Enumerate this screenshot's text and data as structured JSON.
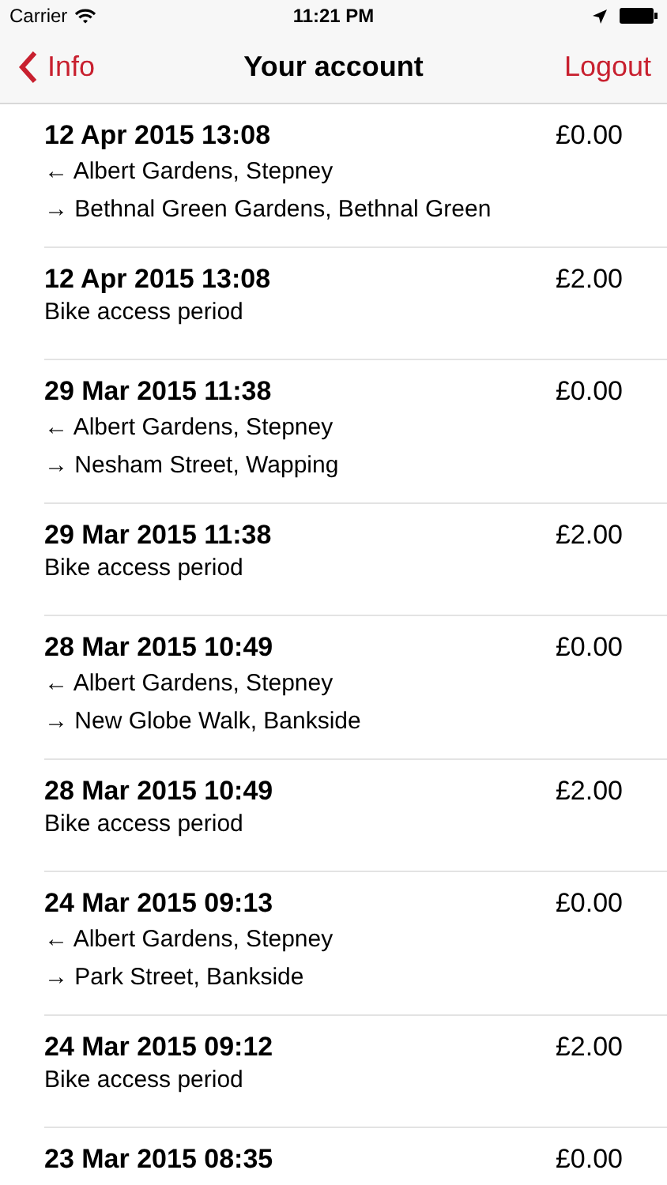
{
  "status_bar": {
    "carrier": "Carrier",
    "time": "11:21 PM"
  },
  "nav": {
    "back": "Info",
    "title": "Your account",
    "action": "Logout"
  },
  "rows": [
    {
      "kind": "trip",
      "date": "12 Apr 2015 13:08",
      "amount": "£0.00",
      "from": "← Albert Gardens, Stepney",
      "to": "→ Bethnal Green Gardens, Bethnal Green"
    },
    {
      "kind": "access",
      "date": "12 Apr 2015 13:08",
      "amount": "£2.00",
      "description": "Bike access period"
    },
    {
      "kind": "trip",
      "date": "29 Mar 2015 11:38",
      "amount": "£0.00",
      "from": "← Albert Gardens, Stepney",
      "to": "→ Nesham Street, Wapping"
    },
    {
      "kind": "access",
      "date": "29 Mar 2015 11:38",
      "amount": "£2.00",
      "description": "Bike access period"
    },
    {
      "kind": "trip",
      "date": "28 Mar 2015 10:49",
      "amount": "£0.00",
      "from": "← Albert Gardens, Stepney",
      "to": "→ New Globe Walk, Bankside"
    },
    {
      "kind": "access",
      "date": "28 Mar 2015 10:49",
      "amount": "£2.00",
      "description": "Bike access period"
    },
    {
      "kind": "trip",
      "date": "24 Mar 2015 09:13",
      "amount": "£0.00",
      "from": "← Albert Gardens, Stepney",
      "to": "→ Park Street, Bankside"
    },
    {
      "kind": "access",
      "date": "24 Mar 2015 09:12",
      "amount": "£2.00",
      "description": "Bike access period"
    },
    {
      "kind": "cut",
      "date": "23 Mar 2015 08:35",
      "amount": "£0.00"
    }
  ]
}
